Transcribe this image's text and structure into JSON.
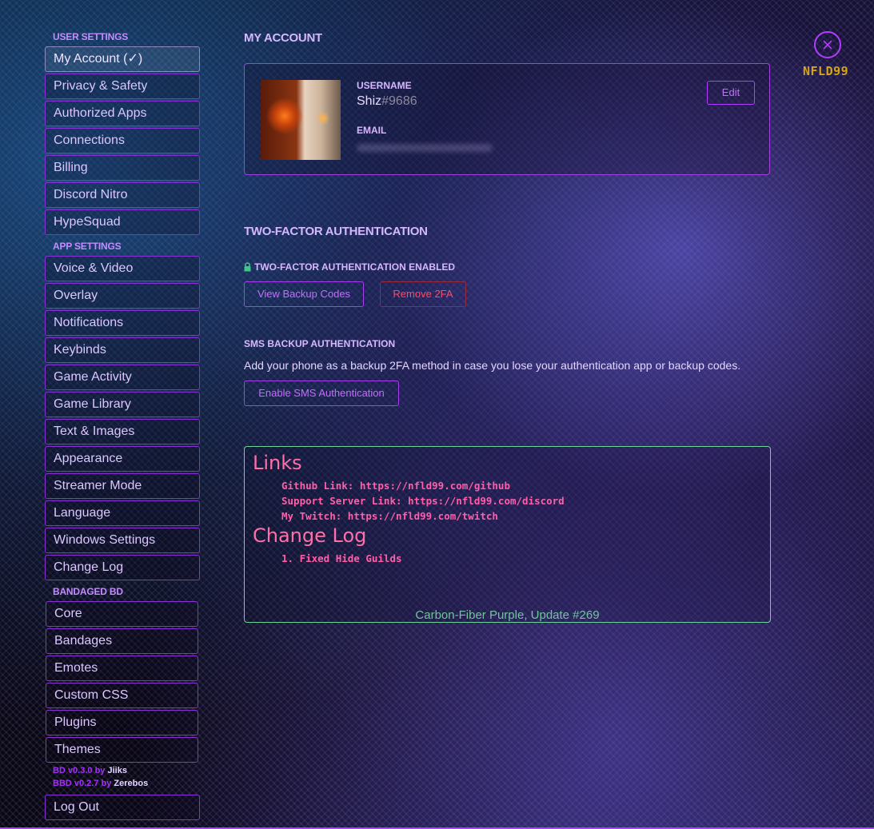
{
  "sidebar": {
    "user_settings_header": "USER SETTINGS",
    "user_items": [
      {
        "label": "My Account (✓)"
      },
      {
        "label": "Privacy & Safety"
      },
      {
        "label": "Authorized Apps"
      },
      {
        "label": "Connections"
      },
      {
        "label": "Billing"
      },
      {
        "label": "Discord Nitro"
      },
      {
        "label": "HypeSquad"
      }
    ],
    "app_settings_header": "APP SETTINGS",
    "app_items": [
      {
        "label": "Voice & Video"
      },
      {
        "label": "Overlay"
      },
      {
        "label": "Notifications"
      },
      {
        "label": "Keybinds"
      },
      {
        "label": "Game Activity"
      },
      {
        "label": "Game Library"
      },
      {
        "label": "Text & Images"
      },
      {
        "label": "Appearance"
      },
      {
        "label": "Streamer Mode"
      },
      {
        "label": "Language"
      },
      {
        "label": "Windows Settings"
      },
      {
        "label": "Change Log"
      }
    ],
    "bandaged_header": "BANDAGED BD",
    "bd_items": [
      {
        "label": "Core"
      },
      {
        "label": "Bandages"
      },
      {
        "label": "Emotes"
      },
      {
        "label": "Custom CSS"
      },
      {
        "label": "Plugins"
      },
      {
        "label": "Themes"
      }
    ],
    "versions": [
      {
        "version": "BD v0.3.0 by ",
        "author": "Jiiks"
      },
      {
        "version": "BBD v0.2.7 by ",
        "author": "Zerebos"
      }
    ],
    "logout_label": "Log Out"
  },
  "account": {
    "title": "MY ACCOUNT",
    "username_label": "USERNAME",
    "username": "Shiz",
    "discriminator": "#9686",
    "email_label": "EMAIL",
    "edit_label": "Edit"
  },
  "two_factor": {
    "title": "TWO-FACTOR AUTHENTICATION",
    "enabled_label": "TWO-FACTOR AUTHENTICATION ENABLED",
    "view_codes_label": "View Backup Codes",
    "remove_label": "Remove 2FA",
    "sms_title": "SMS BACKUP AUTHENTICATION",
    "sms_description": "Add your phone as a backup 2FA method in case you lose your authentication app or backup codes.",
    "enable_sms_label": "Enable SMS Authentication"
  },
  "links": {
    "title": "Links",
    "items": [
      "Github Link: https://nfld99.com/github",
      "Support Server Link: https://nfld99.com/discord",
      "My Twitch: https://nfld99.com/twitch"
    ],
    "changelog_title": "Change Log",
    "changelog_items": [
      "1. Fixed Hide Guilds"
    ],
    "footer": "Carbon-Fiber Purple, Update #269"
  },
  "brand": {
    "logo_text": "NFLD99"
  },
  "icons": {
    "close": "close-icon",
    "lock": "lock-icon"
  },
  "colors": {
    "accent": "#b23cff",
    "danger": "#ff4a64",
    "links_border": "#6fd49c",
    "brand": "#d4a514"
  }
}
